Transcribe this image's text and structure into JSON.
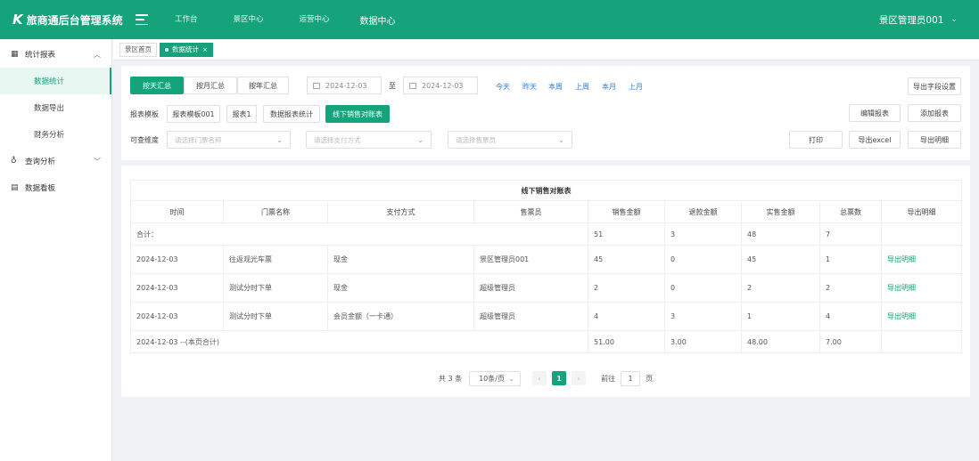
{
  "header": {
    "logo_mark": "K",
    "app_title": "旅商通后台管理系统",
    "nav": [
      "工作台",
      "景区中心",
      "运营中心",
      "数据中心"
    ],
    "user_name": "景区管理员001"
  },
  "sidebar": {
    "groups": [
      {
        "label": "统计报表",
        "icon": "table-icon",
        "expanded": true,
        "items": [
          "数据统计",
          "数据导出",
          "财务分析"
        ]
      },
      {
        "label": "查询分析",
        "icon": "headset-icon",
        "expanded": false
      },
      {
        "label": "数据看板",
        "icon": "board-icon",
        "expanded": false
      }
    ],
    "active_item": "数据统计"
  },
  "tabs": [
    {
      "label": "景区首页",
      "active": false
    },
    {
      "label": "数据统计",
      "active": true,
      "close": "×"
    }
  ],
  "filters": {
    "summary_buttons": [
      "按天汇总",
      "按月汇总",
      "按年汇总"
    ],
    "active_summary": "按天汇总",
    "date_start": "2024-12-03",
    "date_sep": "至",
    "date_end": "2024-12-03",
    "quick_ranges": [
      "今天",
      "昨天",
      "本周",
      "上周",
      "本月",
      "上月"
    ],
    "export_fields_button": "导出字段设置",
    "template_label": "报表模板",
    "templates": [
      "报表模板001",
      "报表1",
      "数据报表统计",
      "线下销售对账表"
    ],
    "active_template": "线下销售对账表",
    "edit_button": "编辑报表",
    "add_button": "添加报表",
    "dimension_label": "可查维度",
    "selects": [
      "请选择门票名称",
      "请选择支付方式",
      "请选择售票员"
    ],
    "print_button": "打印",
    "export_excel_button": "导出excel",
    "export_detail_button": "导出明细"
  },
  "table": {
    "caption": "线下销售对账表",
    "columns": [
      "时间",
      "门票名称",
      "支付方式",
      "售票员",
      "销售金额",
      "退款金额",
      "实售金额",
      "总票数",
      "导出明细"
    ],
    "summary_row": {
      "label": "合计：",
      "sales": "51",
      "refund": "3",
      "actual": "48",
      "tickets": "7"
    },
    "rows": [
      {
        "time": "2024-12-03",
        "ticket": "往返观光车票",
        "payment": "现金",
        "seller": "景区管理员001",
        "sales": "45",
        "refund": "0",
        "actual": "45",
        "tickets": "1",
        "detail": "导出明细"
      },
      {
        "time": "2024-12-03",
        "ticket": "测试分时下单",
        "payment": "现金",
        "seller": "超级管理员",
        "sales": "2",
        "refund": "0",
        "actual": "2",
        "tickets": "2",
        "detail": "导出明细"
      },
      {
        "time": "2024-12-03",
        "ticket": "测试分时下单",
        "payment": "会员金额（一卡通）",
        "seller": "超级管理员",
        "sales": "4",
        "refund": "3",
        "actual": "1",
        "tickets": "4",
        "detail": "导出明细"
      }
    ],
    "footer_row": {
      "label": "2024-12-03 --(本页合计)",
      "sales": "51.00",
      "refund": "3.00",
      "actual": "48.00",
      "tickets": "7.00"
    }
  },
  "pagination": {
    "total": "共 3 条",
    "page_size": "10条/页",
    "prev": "‹",
    "current": "1",
    "next": "›",
    "goto_label": "前往",
    "goto_value": "1",
    "goto_suffix": "页"
  },
  "colors": {
    "primary": "#14a37a",
    "link": "#2d7cd6",
    "background": "#f0f2f5"
  }
}
